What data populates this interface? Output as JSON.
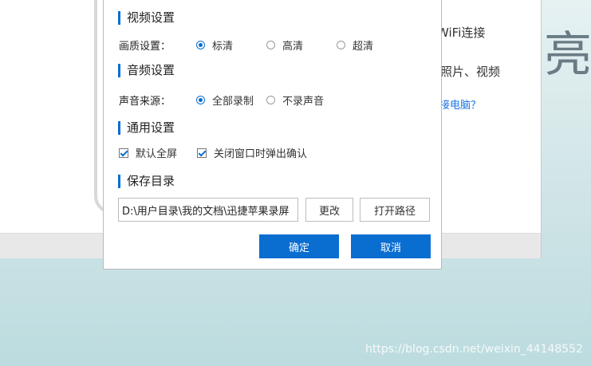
{
  "background": {
    "text_wifi": "WiFi连接",
    "text_photos": "照片、视频",
    "link_connect": "接电脑？",
    "deco_char": "亮",
    "watermark": "https://blog.csdn.net/weixin_44148552"
  },
  "dialog": {
    "video": {
      "title": "视频设置",
      "quality_label": "画质设置：",
      "options": [
        {
          "label": "标清",
          "selected": true
        },
        {
          "label": "高清",
          "selected": false
        },
        {
          "label": "超清",
          "selected": false
        }
      ]
    },
    "audio": {
      "title": "音频设置",
      "source_label": "声音来源：",
      "options": [
        {
          "label": "全部录制",
          "selected": true
        },
        {
          "label": "不录声音",
          "selected": false
        }
      ]
    },
    "general": {
      "title": "通用设置",
      "checkboxes": [
        {
          "label": "默认全屏",
          "checked": true
        },
        {
          "label": "关闭窗口时弹出确认",
          "checked": true
        }
      ]
    },
    "save": {
      "title": "保存目录",
      "path_value": "D:\\用户目录\\我的文档\\迅捷苹果录屏",
      "change_label": "更改",
      "open_path_label": "打开路径"
    },
    "confirm_label": "确定",
    "cancel_label": "取消"
  },
  "colors": {
    "accent": "#0a6ed1"
  }
}
